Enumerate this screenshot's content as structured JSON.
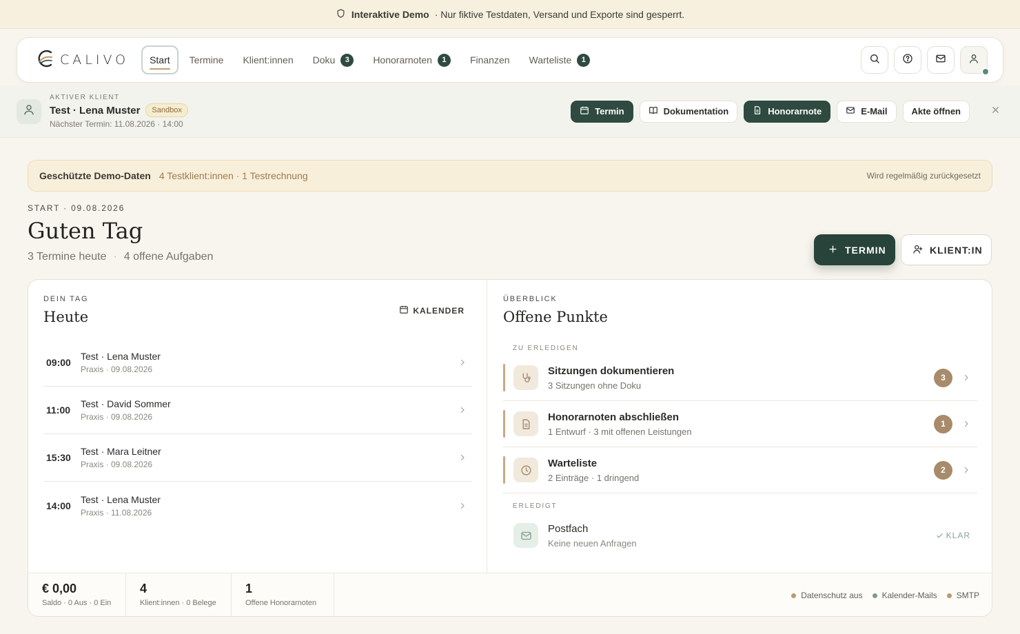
{
  "banner": {
    "strong": "Interaktive Demo",
    "text": "· Nur fiktive Testdaten, Versand und Exporte sind gesperrt."
  },
  "nav": {
    "brand": "CALIVO",
    "tabs": [
      {
        "label": "Start",
        "active": true
      },
      {
        "label": "Termine"
      },
      {
        "label": "Klient:innen"
      },
      {
        "label": "Doku",
        "count": "3"
      },
      {
        "label": "Honorarnoten",
        "count": "1"
      },
      {
        "label": "Finanzen"
      },
      {
        "label": "Warteliste",
        "count": "1"
      }
    ],
    "icons": [
      "search-icon",
      "help-icon",
      "mail-icon",
      "user-icon"
    ]
  },
  "client": {
    "kicker": "Aktiver Klient",
    "name": "Test · Lena Muster",
    "badge": "Sandbox",
    "next": "Nächster Termin: 11.08.2026 · 14:00",
    "actions": {
      "termin": "Termin",
      "doku": "Dokumentation",
      "honorar": "Honorarnote",
      "email": "E-Mail",
      "akte": "Akte öffnen"
    }
  },
  "notice": {
    "title": "Geschützte Demo-Daten",
    "sub": "4 Testklient:innen · 1 Testrechnung",
    "right": "Wird regelmäßig zurückgesetzt"
  },
  "header": {
    "kicker": "START · 09.08.2026",
    "greeting": "Guten Tag",
    "sub1": "3 Termine heute",
    "sep": "·",
    "sub2": "4 offene Aufgaben",
    "btn_termin": "TERMIN",
    "btn_klient": "KLIENT:IN"
  },
  "today": {
    "kicker": "Dein Tag",
    "title": "Heute",
    "calendar": "KALENDER",
    "appointments": [
      {
        "time": "09:00",
        "name": "Test · Lena Muster",
        "meta": "Praxis · 09.08.2026"
      },
      {
        "time": "11:00",
        "name": "Test · David Sommer",
        "meta": "Praxis · 09.08.2026"
      },
      {
        "time": "15:30",
        "name": "Test · Mara Leitner",
        "meta": "Praxis · 09.08.2026"
      },
      {
        "time": "14:00",
        "name": "Test · Lena Muster",
        "meta": "Praxis · 11.08.2026"
      }
    ]
  },
  "overview": {
    "kicker": "Überblick",
    "title": "Offene Punkte",
    "todo_label": "Zu erledigen",
    "todos": [
      {
        "title": "Sitzungen dokumentieren",
        "sub": "3 Sitzungen ohne Doku",
        "count": "3",
        "icon": "stethoscope-icon"
      },
      {
        "title": "Honorarnoten abschließen",
        "sub": "1 Entwurf · 3 mit offenen Leistungen",
        "count": "1",
        "icon": "document-icon"
      },
      {
        "title": "Warteliste",
        "sub": "2 Einträge · 1 dringend",
        "count": "2",
        "icon": "clock-icon"
      }
    ],
    "done_label": "Erledigt",
    "done": {
      "title": "Postfach",
      "sub": "Keine neuen Anfragen",
      "status": "KLAR",
      "icon": "mail-icon"
    }
  },
  "stats": [
    {
      "value": "€ 0,00",
      "label": "Saldo · 0 Aus · 0 Ein"
    },
    {
      "value": "4",
      "label": "Klient:innen · 0 Belege"
    },
    {
      "value": "1",
      "label": "Offene Honorarnoten"
    }
  ],
  "status": [
    {
      "label": "Datenschutz aus",
      "color": "#b89a72"
    },
    {
      "label": "Kalender-Mails",
      "color": "#7f9a86"
    },
    {
      "label": "SMTP",
      "color": "#b89a72"
    }
  ],
  "colors": {
    "accent_dark": "#2f4a40",
    "accent_warm": "#a78b6a",
    "background": "#f8f5ee"
  }
}
